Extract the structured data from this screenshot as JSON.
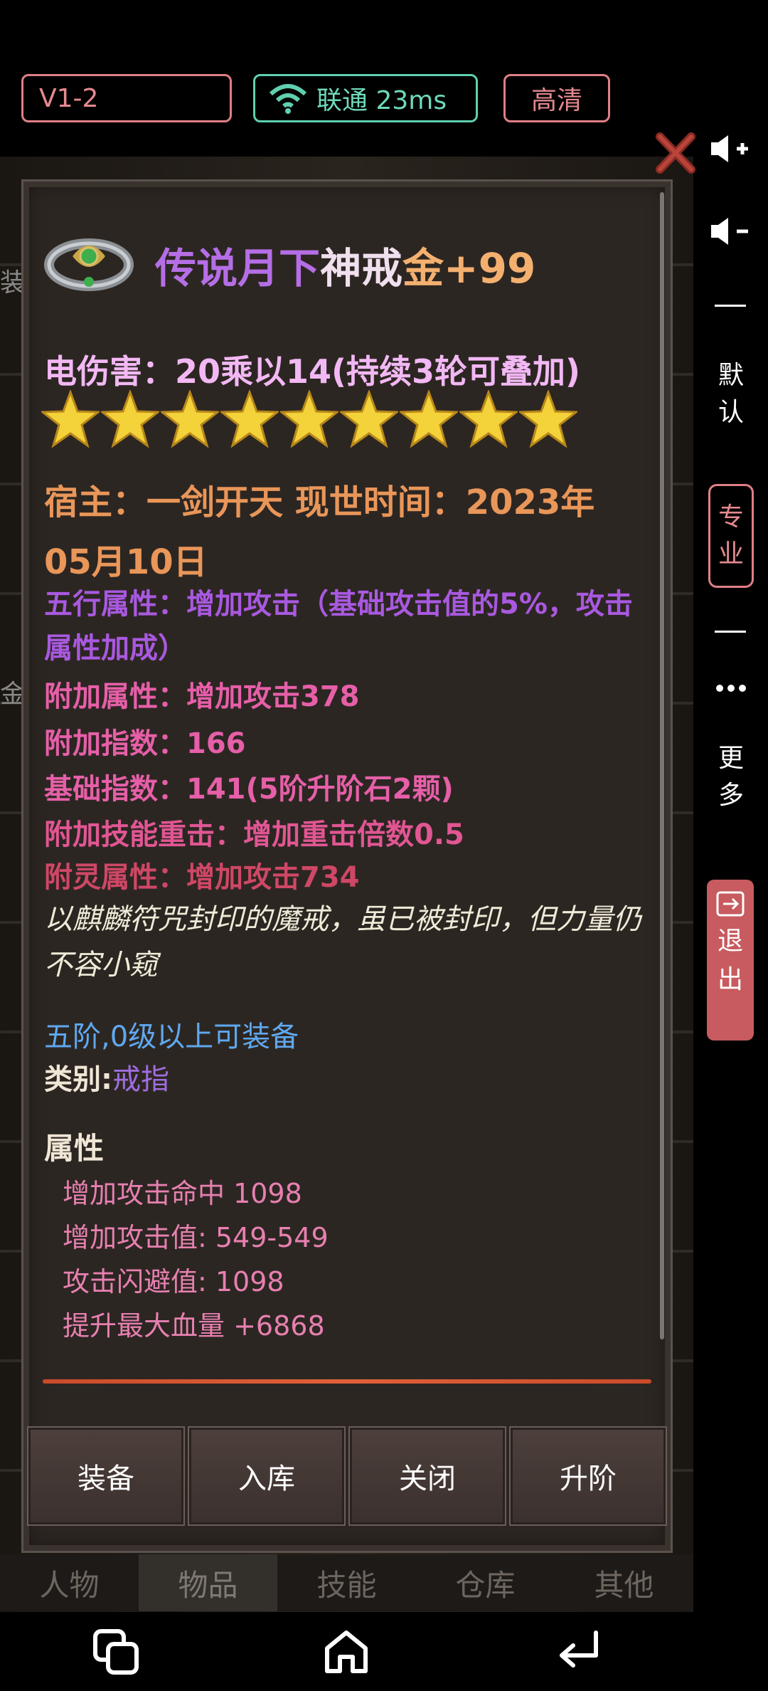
{
  "status": {
    "version": "V1-2",
    "network": "联通 23ms",
    "quality": "高清"
  },
  "side": {
    "default_label": [
      "默",
      "认"
    ],
    "pro_label": [
      "专",
      "业"
    ],
    "more_label": [
      "更",
      "多"
    ],
    "exit_label": [
      "退",
      "出"
    ]
  },
  "item": {
    "title_prefix": "传说月下",
    "title_mid": "神戒",
    "title_suffix": "金+99",
    "elec_damage": "电伤害：20乘以14(持续3轮可叠加)",
    "stars": 9,
    "host_line": "宿主：一剑开天 现世时间：2023年05月10日",
    "wuxing": "五行属性：增加攻击（基础攻击值的5%，攻击属性加成）",
    "attr_add": "附加属性：增加攻击378",
    "attr_index": "附加指数：166",
    "attr_base": "基础指数：141(5阶升阶石2颗)",
    "attr_skill": "附加技能重击：增加重击倍数0.5",
    "attr_spirit": "附灵属性：增加攻击734",
    "lore": "以麒麟符咒封印的魔戒，虽已被封印，但力量仍不容小窥",
    "require": "五阶,0级以上可装备",
    "category_label": "类别:",
    "category_value": "戒指",
    "props_title": "属性",
    "props": [
      "增加攻击命中 1098",
      "增加攻击值:  549-549",
      "攻击闪避值: 1098",
      "提升最大血量 +6868"
    ]
  },
  "buttons": {
    "equip": "装备",
    "store": "入库",
    "close": "关闭",
    "upgrade": "升阶"
  },
  "tabs": [
    "人物",
    "物品",
    "技能",
    "仓库",
    "其他"
  ],
  "edge_chars": [
    "装",
    "金"
  ]
}
